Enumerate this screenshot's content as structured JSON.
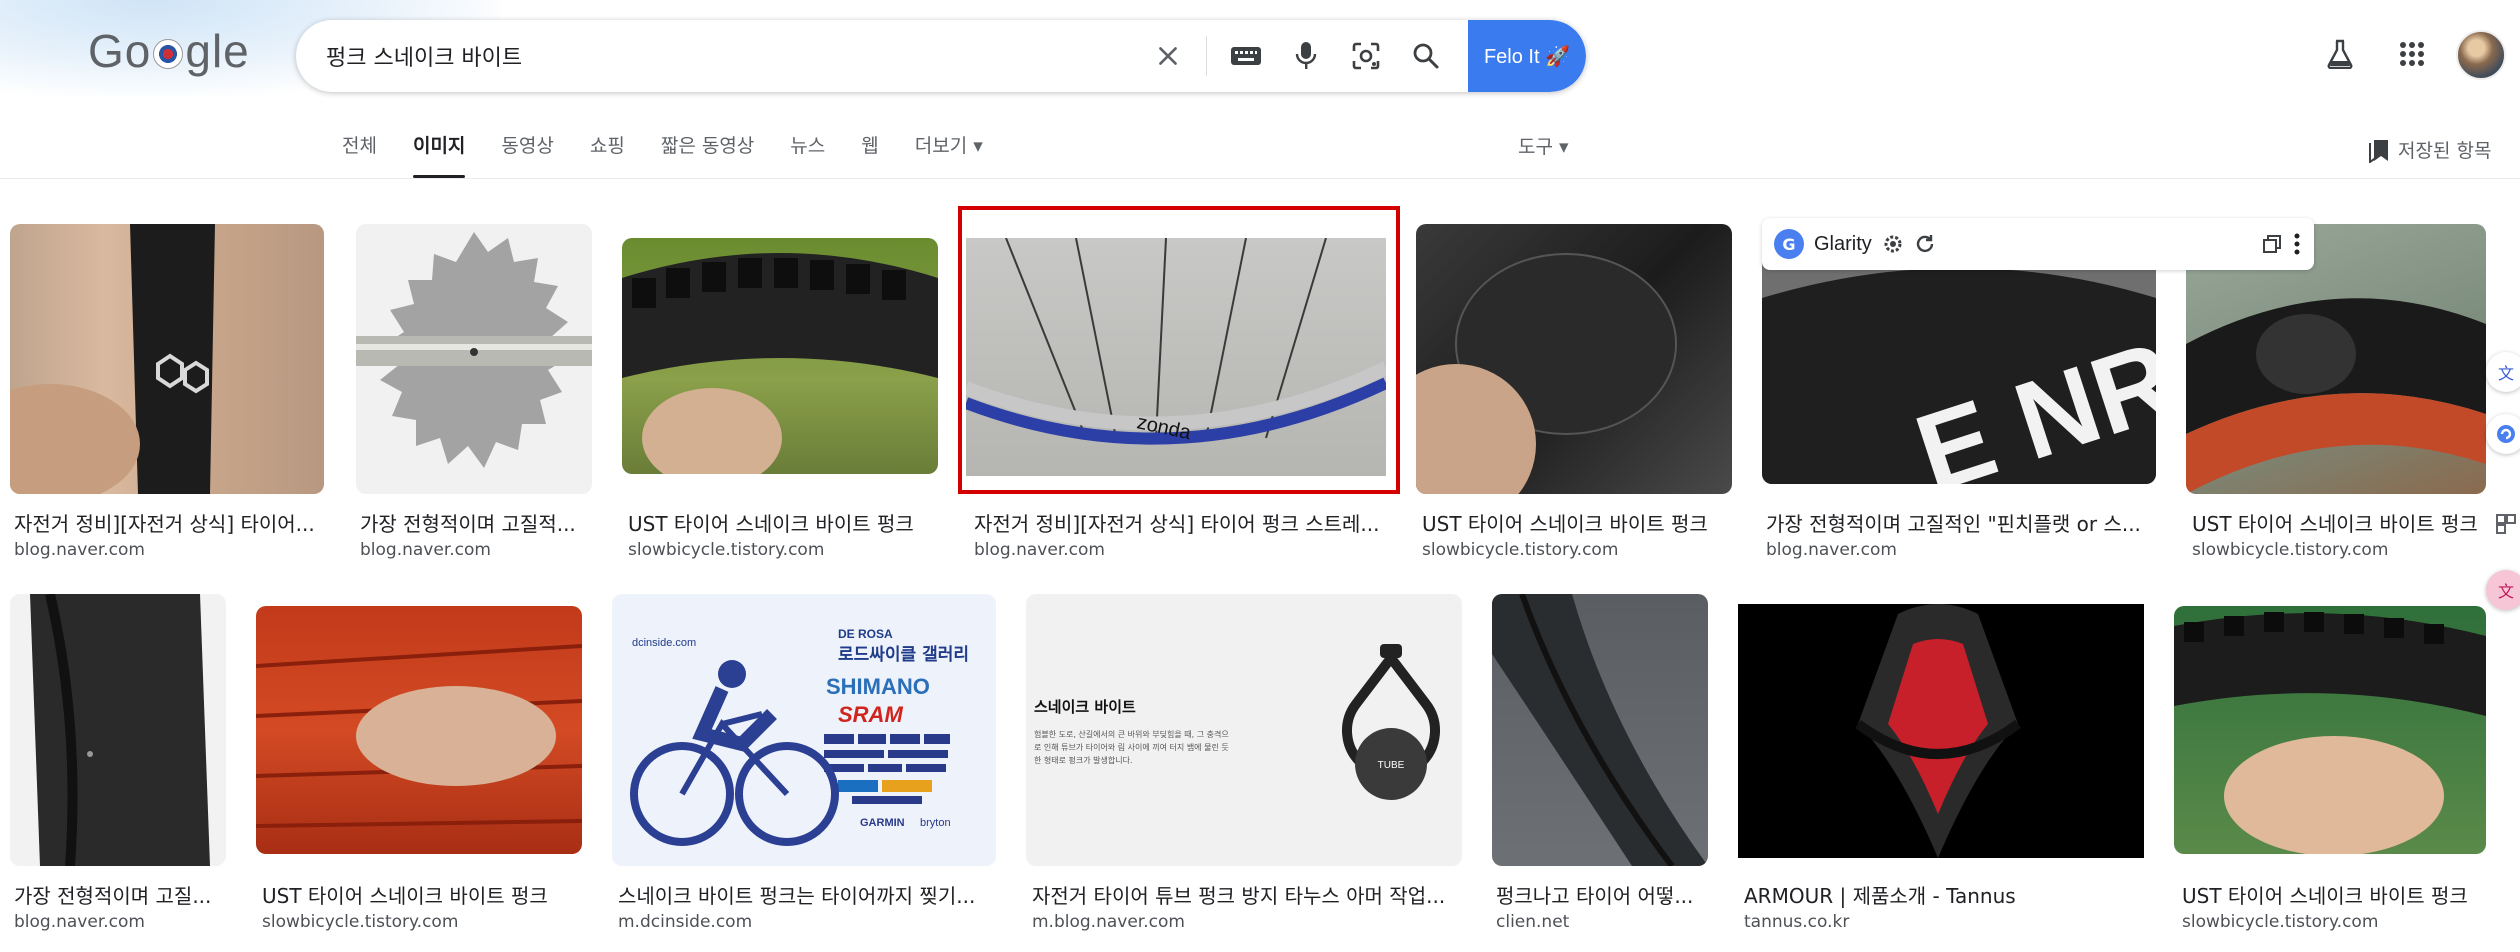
{
  "header": {
    "logo_text": "G gle",
    "search": {
      "value": "펑크 스네이크 바이트",
      "placeholder": ""
    },
    "felo_button": "Felo It 🚀"
  },
  "tabs": [
    "전체",
    "이미지",
    "동영상",
    "쇼핑",
    "짧은 동영상",
    "뉴스",
    "웹",
    "더보기 ▾"
  ],
  "active_tab": "이미지",
  "tools_label": "도구 ▾",
  "saved_label": "저장된 항목",
  "glarity": {
    "name": "Glarity"
  },
  "results_row1": [
    {
      "caption": "자전거 정비][자전거 상식] 타이어...",
      "source": "blog.naver.com"
    },
    {
      "caption": "가장 전형적이며 고질적...",
      "source": "blog.naver.com"
    },
    {
      "caption": "UST 타이어 스네이크 바이트 펑크",
      "source": "slowbicycle.tistory.com"
    },
    {
      "caption": "자전거 정비][자전거 상식] 타이어 펑크 스트레...",
      "source": "blog.naver.com"
    },
    {
      "caption": "UST 타이어 스네이크 바이트 펑크",
      "source": "slowbicycle.tistory.com"
    },
    {
      "caption": "가장 전형적이며 고질적인 \"핀치플랫 or 스...",
      "source": "blog.naver.com"
    },
    {
      "caption": "UST 타이어 스네이크 바이트 펑크",
      "source": "slowbicycle.tistory.com"
    }
  ],
  "results_row2": [
    {
      "caption": "가장 전형적이며 고질...",
      "source": "blog.naver.com"
    },
    {
      "caption": "UST 타이어 스네이크 바이트 펑크",
      "source": "slowbicycle.tistory.com"
    },
    {
      "caption": "스네이크 바이트 펑크는 타이어까지 찢기...",
      "source": "m.dcinside.com"
    },
    {
      "caption": "자전거 타이어 튜브 펑크 방지 타누스 아머 작업...",
      "source": "m.blog.naver.com"
    },
    {
      "caption": "펑크나고 타이어 어떻...",
      "source": "clien.net"
    },
    {
      "caption": "ARMOUR | 제품소개 - Tannus",
      "source": "tannus.co.kr"
    },
    {
      "caption": "UST 타이어 스네이크 바이트 펑크",
      "source": "slowbicycle.tistory.com"
    }
  ],
  "image_text": {
    "dc_site": "dcinside.com",
    "dc_brand": "DE ROSA",
    "dc_title": "로드싸이클 갤러리",
    "dc_shimano": "SHIMANO",
    "dc_sram": "SRAM",
    "dc_garmin": "GARMIN",
    "dc_bryton": "bryton",
    "snake_title": "스네이크 바이트",
    "snake_body": "험블한 도로, 산길에서의 큰 바위와 부딪힘을 때, 그 충격으로 인해 튜브가 타이어와 림 사이에 끼여 터지 뱀에 물린 듯한 형태로 펑크가 발생합니다.",
    "tube_label": "TUBE",
    "tire_logo": "E NR",
    "rim_text": "zonda"
  }
}
